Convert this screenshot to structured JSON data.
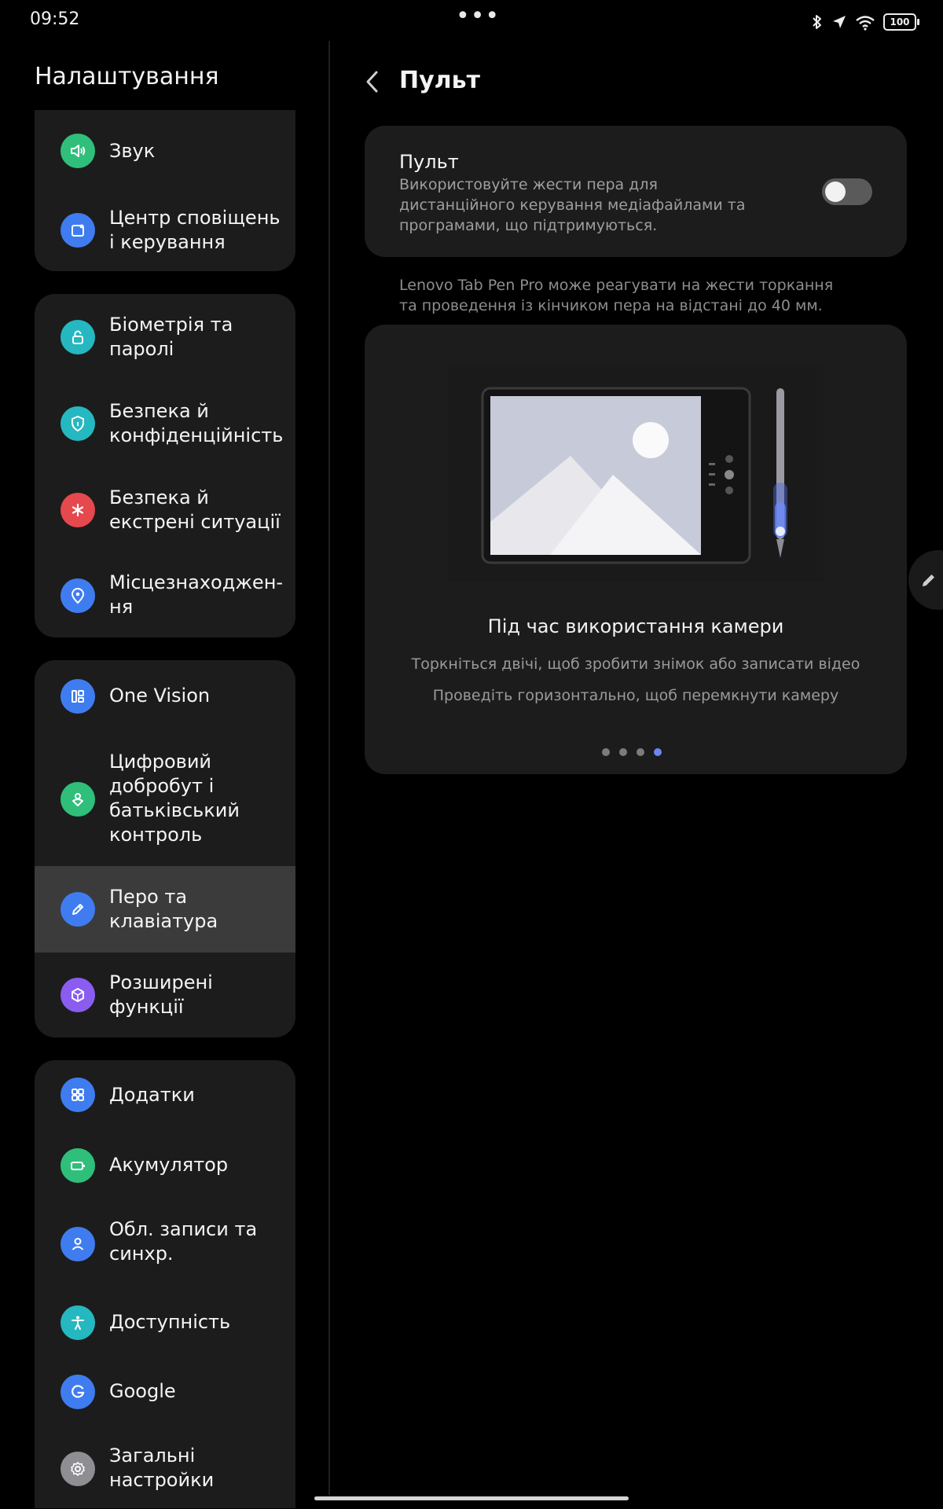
{
  "status": {
    "time": "09:52",
    "more": "•••",
    "battery": "100",
    "icons": [
      "bluetooth-icon",
      "location-icon",
      "wifi-icon",
      "battery-icon"
    ]
  },
  "left": {
    "title": "Налаштування",
    "groups": [
      {
        "items": [
          {
            "label": "Звук",
            "icon": "sound-icon",
            "color": "#2fbf7a"
          },
          {
            "label": "Центр сповіщень\nі керування",
            "icon": "notification-center-icon",
            "color": "#3f7cf0"
          }
        ]
      },
      {
        "items": [
          {
            "label": "Біометрія та\nпаролі",
            "icon": "lock-icon",
            "color": "#25b8c0"
          },
          {
            "label": "Безпека й\nконфіденційність",
            "icon": "shield-icon",
            "color": "#25b8c0"
          },
          {
            "label": "Безпека й\nекстрені ситуації",
            "icon": "emergency-icon",
            "color": "#e5484d"
          },
          {
            "label": "Місцезнаходжен-\nня",
            "icon": "location-pin-icon",
            "color": "#3f7cf0"
          }
        ]
      },
      {
        "items": [
          {
            "label": "One Vision",
            "icon": "one-vision-icon",
            "color": "#3f7cf0"
          },
          {
            "label": "Цифровий\nдобробут і\nбатьківський\nконтроль",
            "icon": "wellbeing-icon",
            "color": "#2fbf7a"
          },
          {
            "label": "Перо та\nклавіатура",
            "icon": "pen-icon",
            "color": "#3f7cf0",
            "selected": true
          },
          {
            "label": "Розширені\nфункції",
            "icon": "advanced-features-icon",
            "color": "#8a5cf0"
          }
        ]
      },
      {
        "items": [
          {
            "label": "Додатки",
            "icon": "apps-icon",
            "color": "#3f7cf0"
          },
          {
            "label": "Акумулятор",
            "icon": "battery-setting-icon",
            "color": "#2fbf7a"
          },
          {
            "label": "Обл. записи та\nсинхр.",
            "icon": "account-icon",
            "color": "#3f7cf0"
          },
          {
            "label": "Доступність",
            "icon": "accessibility-icon",
            "color": "#25b8c0"
          },
          {
            "label": "Google",
            "icon": "google-icon",
            "color": "#3f7cf0"
          },
          {
            "label": "Загальні\nнастройки",
            "icon": "gear-icon",
            "color": "#8e8e93"
          }
        ]
      }
    ]
  },
  "right": {
    "title": "Пульт",
    "toggle": {
      "title": "Пульт",
      "description": "Використовуйте жести пера для дистанційного керування медіафайлами та програмами, що підтримуються.",
      "enabled": false
    },
    "info": "Lenovo Tab Pen Pro може реагувати на жести торкання та проведення із кінчиком пера на відстані до 40 мм.",
    "illustration": {
      "title": "Під час використання камери",
      "line1": "Торкніться двічі, щоб зробити знімок або записати відео",
      "line2": "Проведіть горизонтально, щоб перемкнути камеру",
      "pages": 4,
      "active_page": 4
    }
  },
  "colors": {
    "background": "#000000",
    "card": "#1c1c1c",
    "selected": "#3b3b3b",
    "accent": "#6b88f0"
  }
}
